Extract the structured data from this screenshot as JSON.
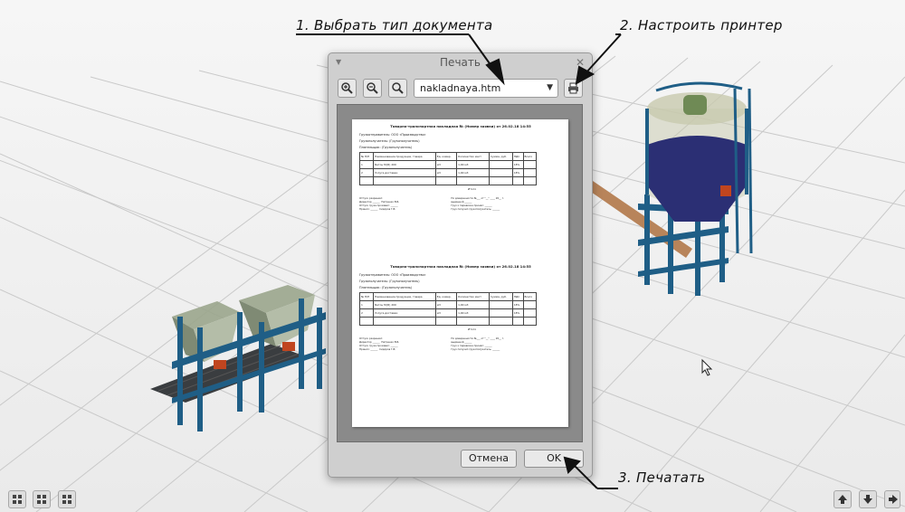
{
  "annotations": {
    "step1": "1. Выбрать тип документа",
    "step2": "2. Настроить принтер",
    "step3": "3. Печатать"
  },
  "dialog": {
    "title": "Печать",
    "file_select_value": "nakladnaya.htm",
    "cancel_label": "Отмена",
    "ok_label": "OK"
  },
  "document": {
    "pages": [
      {
        "title": "Товарно-транспортная накладная № (Номер заявки) от 26.02.18 14:55",
        "lines": [
          "Грузоотправитель: ООО «Производство»",
          "Грузополучатель: (Грузополучатель)",
          "Плательщик: (Грузополучатель)"
        ],
        "headers": [
          "№ П/П",
          "Наименование продукции, товара",
          "Ед. измер.",
          "Количество мест",
          "Сумма, руб.",
          "НДС",
          "Всего"
        ],
        "rows": [
          [
            "1",
            "Бетон М(Ф) 200",
            "м3",
            "1,00 м3",
            "",
            "18%",
            ""
          ],
          [
            "2",
            "Услуга доставки",
            "м3",
            "1,00 м3",
            "",
            "18%",
            ""
          ]
        ],
        "total": "Итого",
        "sign_left": "Отпуск разрешил:\nДиректор ______  Петренко В.Б.\nОтпуск груза произвел: ______\nПринял: ______  Сидоров Г.В.",
        "sign_right": "По доверенности №___ от \"__\" ____ 20__ г.\nвыданной ______\nГруз к перевозке принял: ______\nГруз получил грузополучатель: ______"
      },
      {
        "title": "Товарно-транспортная накладная № (Номер заявки) от 26.02.18 14:55",
        "lines": [
          "Грузоотправитель: ООО «Производство»",
          "Грузополучатель: (Грузополучатель)",
          "Плательщик: (Грузополучатель)"
        ],
        "headers": [
          "№ П/П",
          "Наименование продукции, товара",
          "Ед. измер.",
          "Количество мест",
          "Сумма, руб.",
          "НДС",
          "Всего"
        ],
        "rows": [
          [
            "1",
            "Бетон М(Ф) 200",
            "м3",
            "1,00 м3",
            "",
            "18%",
            ""
          ],
          [
            "2",
            "Услуга доставки",
            "м3",
            "1,00 м3",
            "",
            "18%",
            ""
          ]
        ],
        "total": "Итого",
        "sign_left": "Отпуск разрешил:\nДиректор ______  Петренко В.Б.\nОтпуск груза произвел: ______\nПринял: ______  Сидоров Г.В.",
        "sign_right": "По доверенности №___ от \"__\" ____ 20__ г.\nвыданной ______\nГруз к перевозке принял: ______\nГруз получил грузополучатель: ______"
      }
    ]
  },
  "icons": {
    "zoom_in": "zoom-in-icon",
    "zoom_out": "zoom-out-icon",
    "zoom_reset": "magnifier-icon",
    "printer": "printer-icon",
    "grid": "grid-icon",
    "arrow_up": "arrow-up-icon",
    "arrow_down": "arrow-down-icon",
    "arrow_right": "arrow-right-icon"
  },
  "colors": {
    "steel": "#1f5e86",
    "hopper": "#9aa58c",
    "silo_glass": "#c8c9ae",
    "concrete": "#2b2f74",
    "accent": "#c0451f"
  }
}
